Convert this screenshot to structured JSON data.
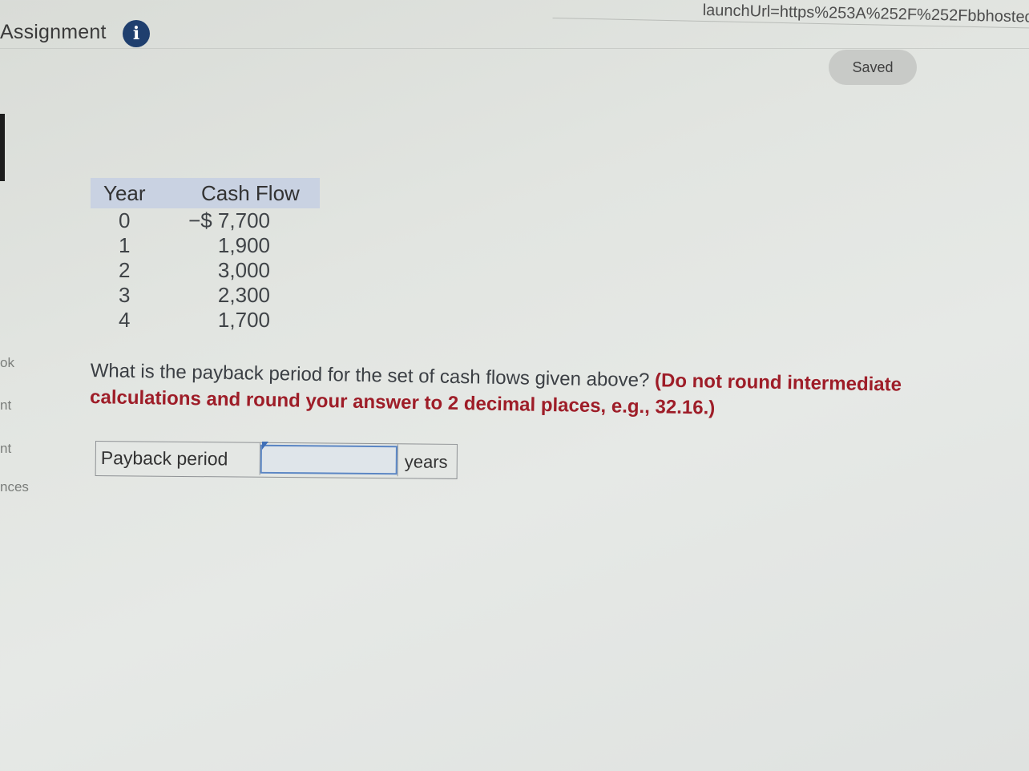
{
  "browser": {
    "url_fragment": "launchUrl=https%253A%252F%252Fbbhosted"
  },
  "header": {
    "title": "Assignment",
    "info_icon": "info-icon",
    "saved_label": "Saved"
  },
  "side_nav": {
    "items": [
      "ok",
      "nt",
      "nt",
      "nces"
    ]
  },
  "table": {
    "headers": [
      "Year",
      "Cash Flow"
    ],
    "rows": [
      {
        "year": "0",
        "cash_flow": "−$ 7,700"
      },
      {
        "year": "1",
        "cash_flow": "1,900"
      },
      {
        "year": "2",
        "cash_flow": "3,000"
      },
      {
        "year": "3",
        "cash_flow": "2,300"
      },
      {
        "year": "4",
        "cash_flow": "1,700"
      }
    ]
  },
  "question": {
    "text": "What is the payback period for the set of cash flows given above?",
    "instruction": "(Do not round intermediate calculations and round your answer to 2 decimal places, e.g., 32.16.)"
  },
  "answer": {
    "label": "Payback period",
    "value": "",
    "unit": "years"
  },
  "colors": {
    "info_icon_bg": "#1f3f6e",
    "table_header_bg": "#c9d2e2",
    "instruction_text": "#9e1d28",
    "input_border": "#5b86c4"
  }
}
